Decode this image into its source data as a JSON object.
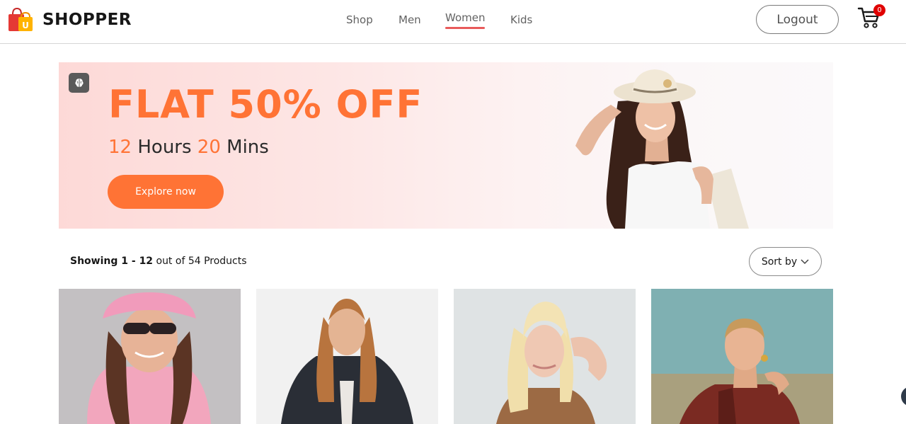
{
  "header": {
    "brand": "SHOPPER",
    "nav": [
      {
        "label": "Shop",
        "active": false
      },
      {
        "label": "Men",
        "active": false
      },
      {
        "label": "Women",
        "active": true
      },
      {
        "label": "Kids",
        "active": false
      }
    ],
    "logout_label": "Logout",
    "cart_count": "0",
    "icons": {
      "logo": "shopping-bag-logo-icon",
      "cart": "cart-icon"
    },
    "accent_color": "#e85a5a"
  },
  "banner": {
    "headline": "FLAT 50% OFF",
    "hours_value": "12",
    "hours_label": " Hours ",
    "mins_value": "20",
    "mins_label": " Mins",
    "cta_label": "Explore now",
    "accent_color": "#ff7335",
    "icons": {
      "badge": "brain-icon"
    }
  },
  "listing": {
    "range_bold": "Showing 1 - 12",
    "range_rest": " out of 54 Products",
    "sort_label": "Sort by",
    "icons": {
      "sort": "chevron-down-icon"
    }
  },
  "products": [
    {
      "image": "woman-pink-bucket-hat-photo"
    },
    {
      "image": "woman-fur-jacket-photo"
    },
    {
      "image": "blonde-woman-photo"
    },
    {
      "image": "woman-red-plaid-top-photo"
    }
  ]
}
